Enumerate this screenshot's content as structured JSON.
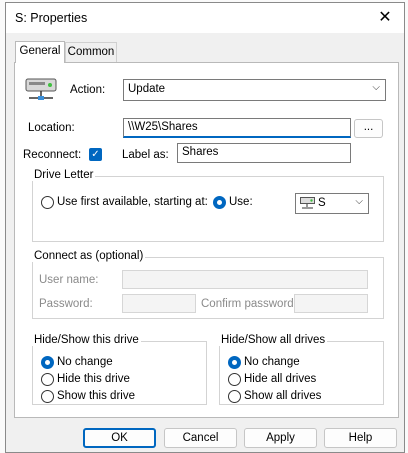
{
  "window": {
    "title": "S: Properties"
  },
  "tabs": [
    {
      "label": "General"
    },
    {
      "label": "Common"
    }
  ],
  "action": {
    "label": "Action:",
    "value": "Update"
  },
  "location": {
    "label": "Location:",
    "value": "\\\\W25\\Shares",
    "browse_label": "..."
  },
  "reconnect": {
    "label": "Reconnect:",
    "checked": true
  },
  "label_as": {
    "label": "Label as:",
    "value": "Shares"
  },
  "drive_letter": {
    "group_title": "Drive Letter",
    "first_available_label": "Use first available, starting at:",
    "use_label": "Use:",
    "drive_value": "S"
  },
  "connect_as": {
    "group_title": "Connect as (optional)",
    "username_label": "User name:",
    "password_label": "Password:",
    "confirm_label": "Confirm password:"
  },
  "hide_show_this": {
    "group_title": "Hide/Show this drive",
    "options": [
      "No change",
      "Hide this drive",
      "Show this drive"
    ],
    "selected": 0
  },
  "hide_show_all": {
    "group_title": "Hide/Show all drives",
    "options": [
      "No change",
      "Hide all drives",
      "Show all drives"
    ],
    "selected": 0
  },
  "buttons": {
    "ok": "OK",
    "cancel": "Cancel",
    "apply": "Apply",
    "help": "Help"
  }
}
